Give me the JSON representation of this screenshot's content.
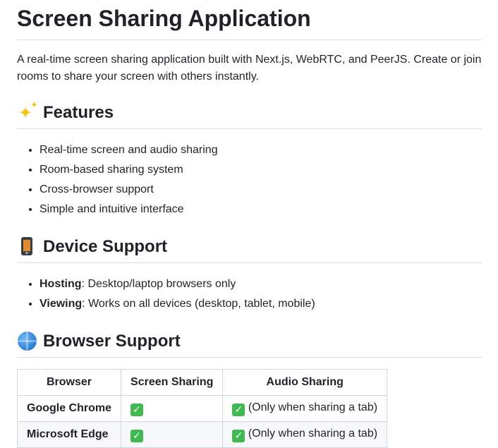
{
  "title": "Screen Sharing Application",
  "intro": "A real-time screen sharing application built with Next.js, WebRTC, and PeerJS. Create or join rooms to share your screen with others instantly.",
  "features": {
    "icon": "sparkles-icon",
    "heading": "Features",
    "items": [
      "Real-time screen and audio sharing",
      "Room-based sharing system",
      "Cross-browser support",
      "Simple and intuitive interface"
    ]
  },
  "device_support": {
    "icon": "mobile-phone-icon",
    "heading": "Device Support",
    "items": [
      {
        "label": "Hosting",
        "text": ": Desktop/laptop browsers only"
      },
      {
        "label": "Viewing",
        "text": ": Works on all devices (desktop, tablet, mobile)"
      }
    ]
  },
  "browser_support": {
    "icon": "globe-icon",
    "heading": "Browser Support",
    "columns": [
      "Browser",
      "Screen Sharing",
      "Audio Sharing"
    ],
    "rows": [
      {
        "browser": "Google Chrome",
        "screen_sharing_note": "",
        "audio_sharing_note": " (Only when sharing a tab)"
      },
      {
        "browser": "Microsoft Edge",
        "screen_sharing_note": "",
        "audio_sharing_note": " (Only when sharing a tab)"
      }
    ]
  },
  "colors": {
    "text": "#1f2328",
    "border": "#d8dee4",
    "check_green": "#3fb950",
    "row_alt": "#f6f8fa"
  }
}
